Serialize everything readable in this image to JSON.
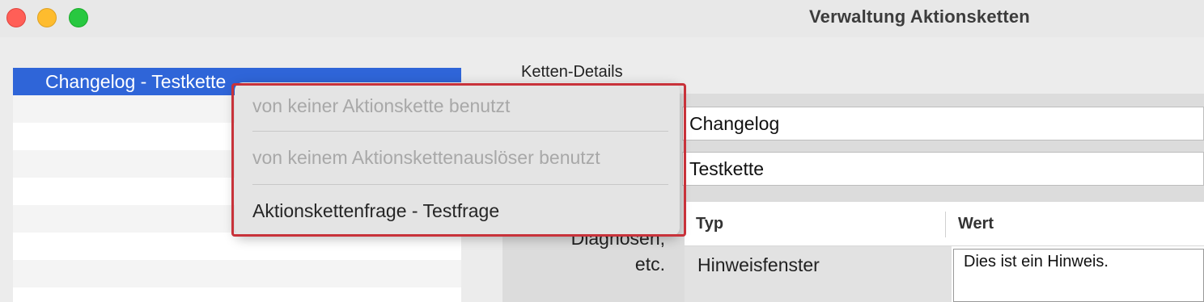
{
  "window": {
    "title": "Verwaltung Aktionsketten"
  },
  "chain_list": {
    "selected_item": "Changelog - Testkette"
  },
  "details": {
    "section_label": "Ketten-Details",
    "field_1_value": "Changelog",
    "field_2_value": "Testkette",
    "side_label_line1": "Diagnosen,",
    "side_label_line2": "etc.",
    "table": {
      "col_typ": "Typ",
      "col_wert": "Wert",
      "rows": [
        {
          "typ": "Hinweisfenster",
          "wert": "Dies ist ein Hinweis."
        }
      ]
    }
  },
  "context_menu": {
    "items": [
      {
        "label": "von keiner Aktionskette benutzt",
        "enabled": false
      },
      {
        "label": "von keinem Aktionskettenauslöser benutzt",
        "enabled": false
      },
      {
        "label": "Aktionskettenfrage - Testfrage",
        "enabled": true
      }
    ],
    "highlight_color": "#c8323a"
  },
  "colors": {
    "selection": "#2f65d8",
    "close": "#ff5f57",
    "minimize": "#febc2e",
    "zoom": "#28c840"
  }
}
